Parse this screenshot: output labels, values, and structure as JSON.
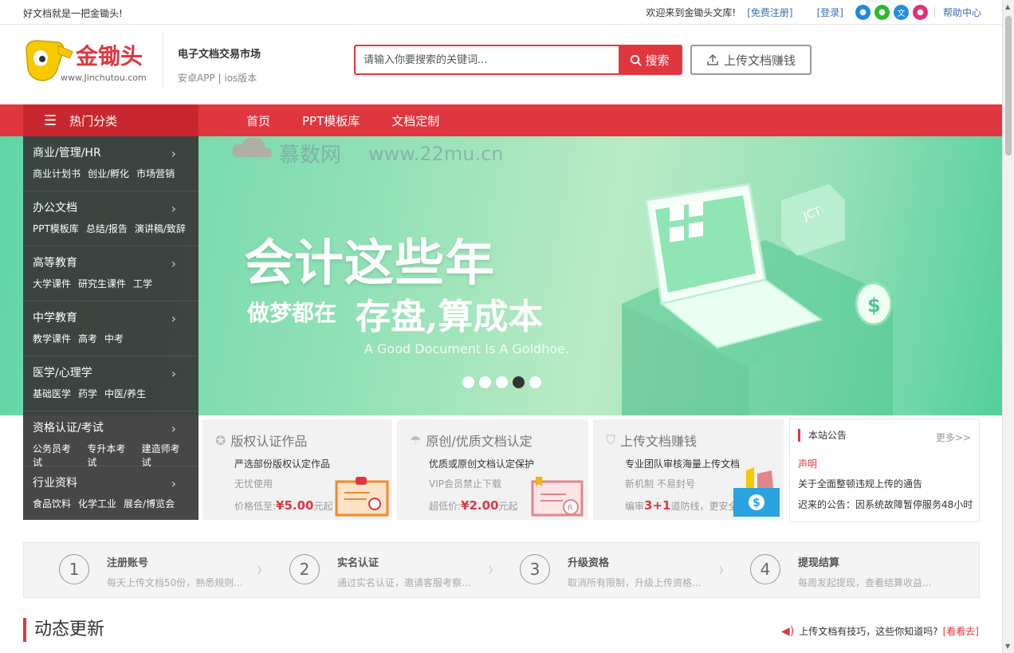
{
  "topbar": {
    "slogan": "好文档就是一把金锄头!",
    "welcome": "欢迎来到金锄头文库!",
    "register": "[免费注册]",
    "login": "[登录]",
    "help": "帮助中心",
    "social": [
      {
        "icon": "weibo-icon",
        "color": "#1e88e5"
      },
      {
        "icon": "wechat-icon",
        "color": "#2eb82e"
      },
      {
        "icon": "baidu-wen-icon",
        "color": "#1e90e5"
      },
      {
        "icon": "qq-icon",
        "color": "#e0307a"
      }
    ]
  },
  "header": {
    "logo_text": "金锄头",
    "logo_url_text": "www.Jinchutou.com",
    "market_title": "电子文档交易市场",
    "market_sub": "安卓APP | ios版本",
    "search_placeholder": "请输入你要搜索的关键词...",
    "search_label": "搜索",
    "upload_label": "上传文档赚钱"
  },
  "nav": {
    "category_label": "热门分类",
    "links": [
      "首页",
      "PPT模板库",
      "文档定制"
    ]
  },
  "banner": {
    "watermark": "慕数网",
    "watermark_url": "www.22mu.cn",
    "headline": "会计这些年",
    "sub_a": "做梦都在",
    "sub_b": "存盘,算成本",
    "english": "A Good Document Is A Goldhoe.",
    "slide_count": 5,
    "active_slide": 4
  },
  "sidemenu": [
    {
      "title": "商业/管理/HR",
      "subs": [
        "商业计划书",
        "创业/孵化",
        "市场营销"
      ]
    },
    {
      "title": "办公文档",
      "subs": [
        "PPT模板库",
        "总结/报告",
        "演讲稿/致辞"
      ]
    },
    {
      "title": "高等教育",
      "subs": [
        "大学课件",
        "研究生课件",
        "工学"
      ]
    },
    {
      "title": "中学教育",
      "subs": [
        "教学课件",
        "高考",
        "中考"
      ]
    },
    {
      "title": "医学/心理学",
      "subs": [
        "基础医学",
        "药学",
        "中医/养生"
      ]
    },
    {
      "title": "资格认证/考试",
      "subs": [
        "公务员考试",
        "专升本考试",
        "建造师考试"
      ]
    },
    {
      "title": "行业资料",
      "subs": [
        "食品饮料",
        "化学工业",
        "展会/博览会"
      ]
    }
  ],
  "cards": [
    {
      "title": "版权认证作品",
      "line1": "严选部份版权认定作品",
      "line2": "无忧使用",
      "price_prefix": "价格低至:",
      "price": "¥5.00",
      "price_suffix": "元起"
    },
    {
      "title": "原创/优质文档认定",
      "line1": "优质或原创文档认定保护",
      "line2": "VIP会员禁止下载",
      "price_prefix": "超低价:",
      "price": "¥2.00",
      "price_suffix": "元起"
    },
    {
      "title": "上传文档赚钱",
      "line1": "专业团队审核海量上传文档",
      "line2": "新机制 不易封号",
      "price_prefix": "编审",
      "price": "3+1",
      "price_suffix": "道防线，更安全"
    }
  ],
  "notice": {
    "title": "本站公告",
    "more": "更多>>",
    "items": [
      "声明",
      "关于全面整顿违规上传的通告",
      "迟来的公告：因系统故障暂停服务48小时"
    ]
  },
  "steps": [
    {
      "num": "1",
      "title": "注册账号",
      "desc": "每天上传文档50份，熟悉规则..."
    },
    {
      "num": "2",
      "title": "实名认证",
      "desc": "通过实名认证，邀请客服考察..."
    },
    {
      "num": "3",
      "title": "升级资格",
      "desc": "取消所有限制，升级上传资格..."
    },
    {
      "num": "4",
      "title": "提现结算",
      "desc": "每周发起提现，查看结算收益..."
    }
  ],
  "dynamic": {
    "title": "动态更新",
    "tip": "上传文档有技巧，这些你知道吗?",
    "tip_link": "[看看去]"
  }
}
